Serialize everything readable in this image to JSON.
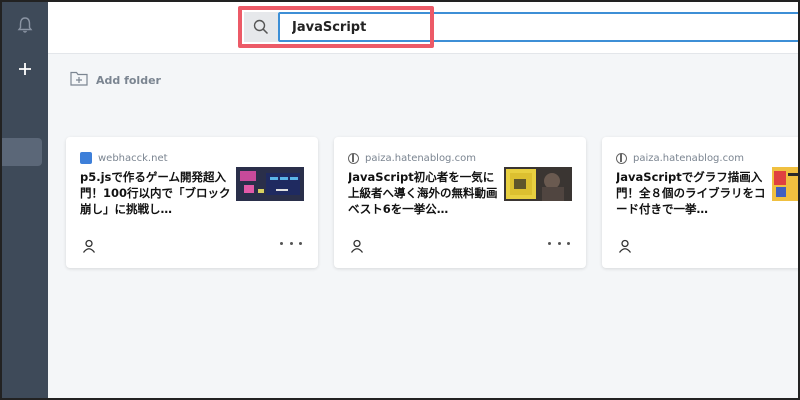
{
  "search": {
    "value": "JavaScript",
    "placeholder": ""
  },
  "sidebar": {
    "items": [
      {
        "icon": "bell-icon"
      },
      {
        "icon": "plus-icon"
      }
    ]
  },
  "toolbar": {
    "add_folder_label": "Add folder"
  },
  "cards": [
    {
      "domain": "webhacck.net",
      "title": "p5.jsで作るゲーム開発超入門！100行以内で「ブロック崩し」に挑戦し…",
      "favicon": "blue-square-icon"
    },
    {
      "domain": "paiza.hatenablog.com",
      "title": "JavaScript初心者を一気に上級者へ導く海外の無料動画ベスト6を一挙公…",
      "favicon": "globe-icon"
    },
    {
      "domain": "paiza.hatenablog.com",
      "title": "JavaScriptでグラフ描画入門！全８個のライブラリをコード付きで一挙…",
      "favicon": "globe-icon"
    }
  ],
  "colors": {
    "sidebar": "#3e4a59",
    "highlight": "#ec5a67",
    "input_border": "#3d8fd6"
  }
}
